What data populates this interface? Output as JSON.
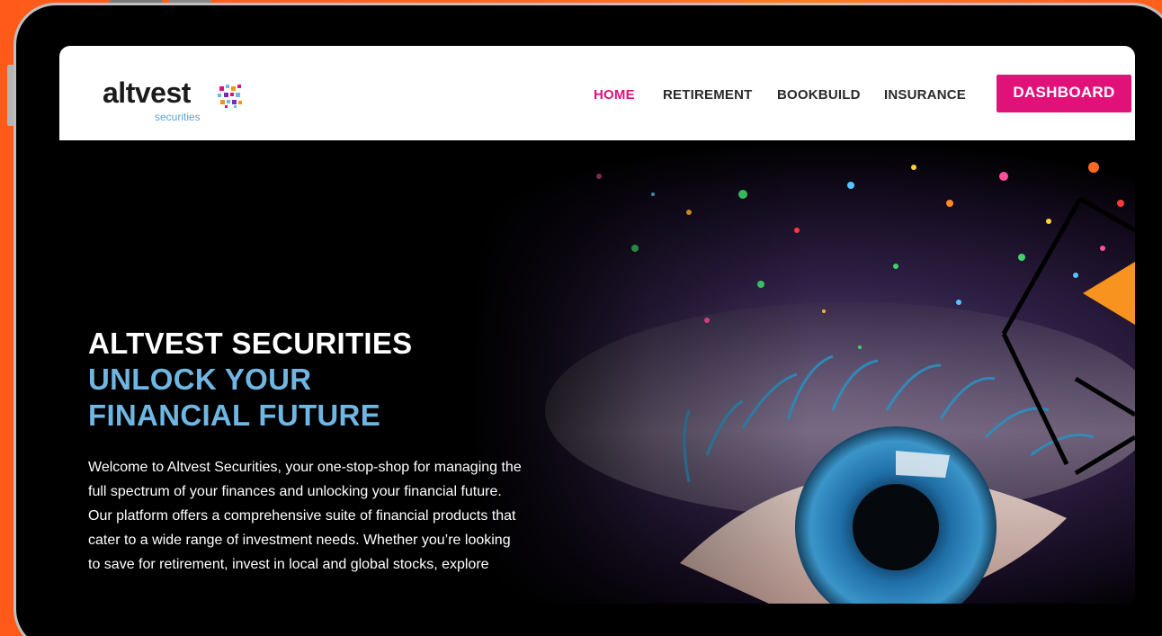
{
  "brand": {
    "wordmark": "altvest",
    "subtitle": "securities",
    "colors": {
      "accent_pink": "#e0127a",
      "accent_blue": "#6fb6e3",
      "frame_orange": "#ff5a1a",
      "hex_orange": "#f7931e"
    }
  },
  "nav": {
    "items": [
      {
        "label": "HOME",
        "active": true
      },
      {
        "label": "RETIREMENT",
        "active": false
      },
      {
        "label": "BOOKBUILD",
        "active": false
      },
      {
        "label": "INSURANCE",
        "active": false
      }
    ],
    "cta_label": "DASHBOARD"
  },
  "hero": {
    "title": "ALTVEST SECURITIES",
    "subtitle_line1": "UNLOCK YOUR",
    "subtitle_line2": "FINANCIAL FUTURE",
    "body_lines": [
      "Welcome to Altvest Securities, your one-stop-shop for managing the",
      "full spectrum of your finances and unlocking your financial future.",
      "Our platform offers a comprehensive suite of financial products that",
      "cater to a wide range of investment needs. Whether you’re looking",
      "to save for retirement, invest in local and global stocks, explore"
    ],
    "image": "eye-closeup-with-paint-splatter"
  }
}
